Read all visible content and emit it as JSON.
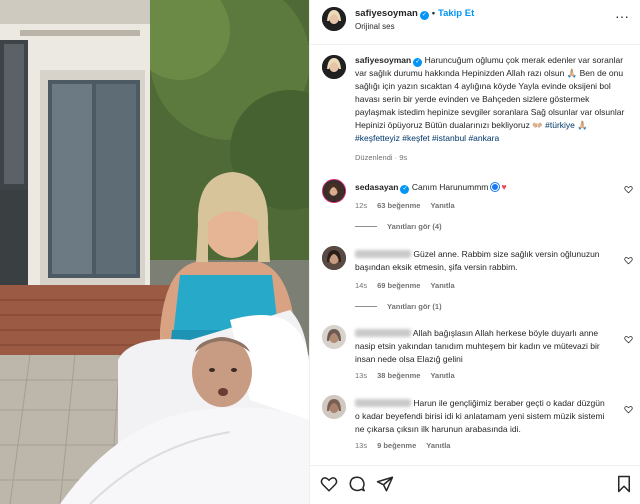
{
  "post": {
    "username": "safiyesoyman",
    "follow_label": "Takip Et",
    "audio_label": "Orijinal ses"
  },
  "caption": {
    "username": "safiyesoyman",
    "text": "Haruncuğum oğlumu çok merak edenler var soranlar var sağlık durumu hakkında Hepinizden Allah razı olsun 🙏🏼 Ben de onu sağlığı için yazın sıcaktan 4 aylığına köyde Yayla evinde oksijeni bol havası serin bir yerde evinden ve Bahçeden sizlere göstermek paylaşmak istedim hepinize sevgiler soranlara Sağ olsunlar var olsunlar Hepinizi öpüyoruz Bütün dualarınızı bekliyoruz 👐🏼",
    "hashtags": [
      "#türkiye",
      "#keşfetteyiz",
      "#keşfet",
      "#istanbul",
      "#ankara"
    ],
    "hashtag_sep_emoji": "🙏🏼",
    "meta": "Düzenlendi · 9s"
  },
  "comments": [
    {
      "username": "sedasayan",
      "text": "Canım Harunummm",
      "time": "12s",
      "likes": "63 beğenme",
      "reply_label": "Yanıtla",
      "view_replies": "Yanıtları gör (4)"
    },
    {
      "username": "",
      "text": "Güzel anne. Rabbim size sağlık versin oğlunuzun başından eksik etmesin, şifa versin rabbim.",
      "time": "14s",
      "likes": "69 beğenme",
      "reply_label": "Yanıtla",
      "view_replies": "Yanıtları gör (1)"
    },
    {
      "username": "",
      "text": "Allah bağışlasın Allah herkese böyle duyarlı anne nasip etsin yakından tanıdım muhteşem bir kadın ve mütevazi bir insan nede olsa Elazığ gelini",
      "time": "13s",
      "likes": "38 beğenme",
      "reply_label": "Yanıtla"
    },
    {
      "username": "",
      "text": "Harun ile gençliğimiz beraber geçti o kadar düzgün o kadar beyefendi birisi idi ki anlatamam yeni sistem müzik sistemi ne çıkarsa çıksın ilk harunun arabasında idi.",
      "time": "13s",
      "likes": "9 beğenme",
      "reply_label": "Yanıtla"
    }
  ],
  "icons": [
    "heart-icon",
    "comment-icon",
    "share-icon",
    "bookmark-icon",
    "more-icon",
    "verified-icon"
  ],
  "colors": {
    "accent": "#0095f6",
    "like": "#ed4956",
    "hashtag": "#00376b",
    "muted": "#737373"
  }
}
